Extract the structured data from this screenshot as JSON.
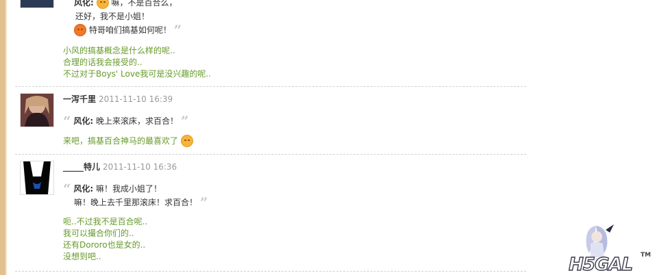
{
  "comments": [
    {
      "quote_name": "风化:",
      "quote_lines": [
        "嘛，不是百合么，",
        "还好，我不是小姐！",
        "特哥咱们搞基如何呢！"
      ],
      "replies": [
        "小风的搞基概念是什么样的呢..",
        "合理的话我会接受的..",
        "不过对于Boys' Love我可是没兴趣的呢.."
      ]
    },
    {
      "author": "一泻千里",
      "time": "2011-11-10 16:39",
      "quote_name": "风化:",
      "quote_lines": [
        "晚上来滚床，求百合！"
      ],
      "replies": [
        "来吧，搞基百合神马的最喜欢了"
      ]
    },
    {
      "author": "_____特儿",
      "time": "2011-11-10 16:36",
      "quote_name": "风化:",
      "quote_lines": [
        "嘛！我成小姐了！",
        "嘛！晚上去千里那滚床！求百合！"
      ],
      "replies": [
        "呃..不过我不是百合呢..",
        "我可以撮合你们的..",
        "还有Dororo也是女的..",
        "没想到吧.."
      ]
    }
  ],
  "icons": {
    "emoji_smile": "smile-emoji-icon",
    "emoji_laugh": "laugh-emoji-icon"
  },
  "colors": {
    "reply_text": "#669a2a",
    "divider": "#cfcfcf",
    "left_strip": "#e2c08f"
  },
  "watermark": {
    "logo_text": "H5GAL",
    "tm": "TM"
  }
}
